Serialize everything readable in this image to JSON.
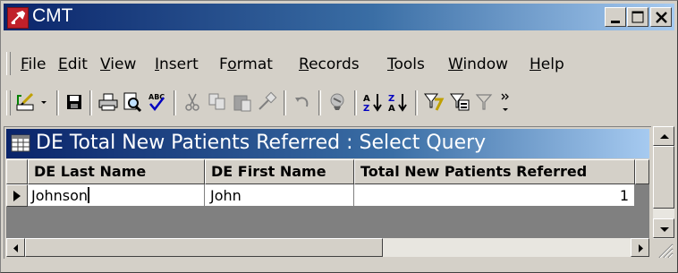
{
  "window": {
    "title": "CMT",
    "icon": "access-key-icon",
    "controls": [
      "minimize-icon",
      "restore-icon",
      "close-icon"
    ]
  },
  "menu": {
    "items": [
      {
        "label": "File",
        "mnemonic": "F",
        "rest": "ile"
      },
      {
        "label": "Edit",
        "mnemonic": "E",
        "rest": "dit"
      },
      {
        "label": "View",
        "mnemonic": "V",
        "rest": "iew"
      },
      {
        "label": "Insert",
        "mnemonic": "I",
        "rest": "nsert"
      },
      {
        "label": "Format",
        "pre": "F",
        "mnemonic": "o",
        "rest": "rmat"
      },
      {
        "label": "Records",
        "mnemonic": "R",
        "rest": "ecords"
      },
      {
        "label": "Tools",
        "mnemonic": "T",
        "rest": "ools"
      },
      {
        "label": "Window",
        "mnemonic": "W",
        "rest": "indow"
      },
      {
        "label": "Help",
        "mnemonic": "H",
        "rest": "elp"
      }
    ]
  },
  "toolbar": {
    "buttons": [
      "design-view-icon",
      "dropdown-arrow-icon",
      "save-icon",
      "print-icon",
      "print-preview-icon",
      "spelling-icon",
      "cut-icon",
      "copy-icon",
      "paste-icon",
      "format-painter-icon",
      "undo-icon",
      "hyperlink-icon",
      "sort-ascending-icon",
      "sort-descending-icon",
      "filter-by-selection-icon",
      "filter-by-form-icon",
      "apply-filter-icon",
      "toolbar-options-icon"
    ]
  },
  "query_window": {
    "title": "DE Total New Patients Referred : Select Query",
    "icon": "query-datasheet-icon",
    "columns": [
      "DE Last Name",
      "DE First Name",
      "Total New Patients Referred"
    ],
    "rows": [
      {
        "DE Last Name": "Johnson",
        "DE First Name": "John",
        "Total New Patients Referred": "1"
      }
    ],
    "current_row_marker": "row-pointer-icon"
  },
  "colors": {
    "titlebar_start": "#0a246a",
    "titlebar_end": "#a6caf0",
    "face": "#d4d0c8"
  }
}
